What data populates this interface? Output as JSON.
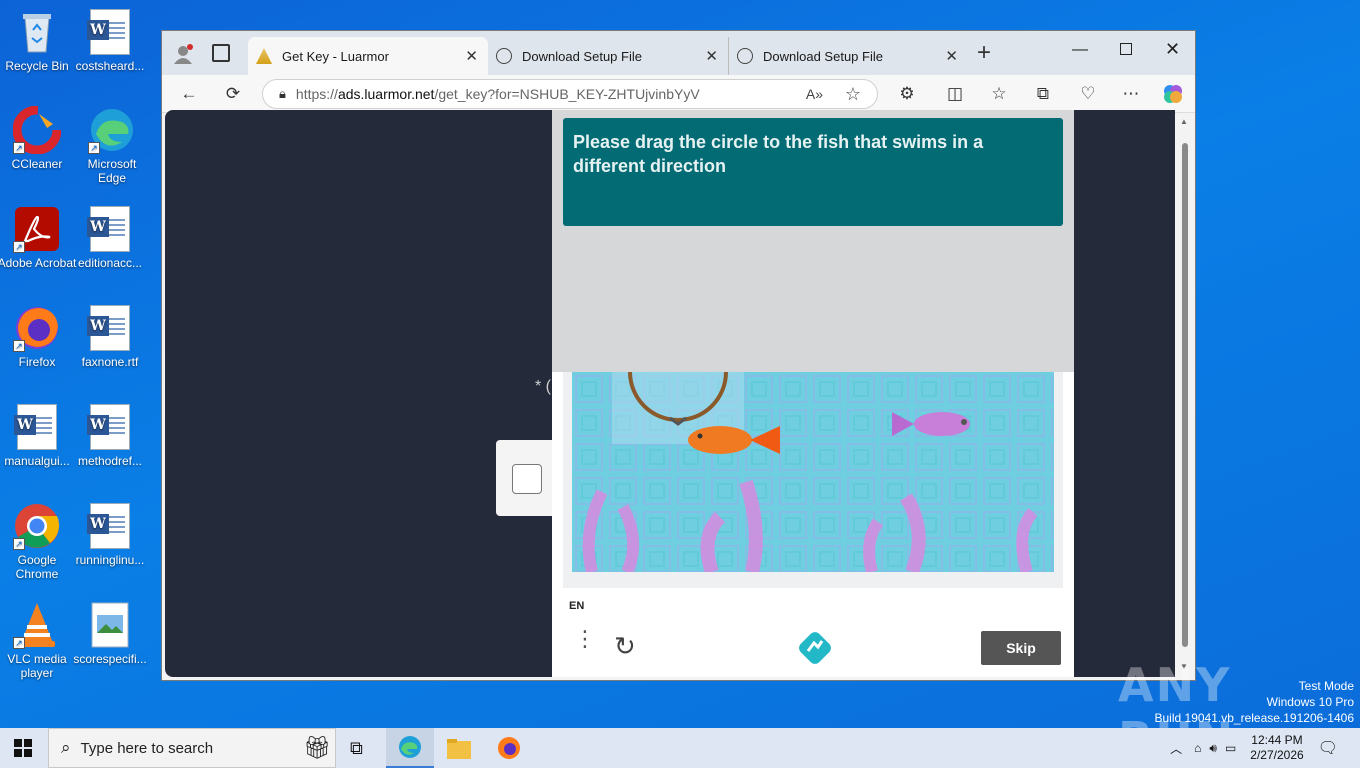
{
  "desktop": {
    "icons": [
      {
        "label": "Recycle Bin"
      },
      {
        "label": "costsheard..."
      },
      {
        "label": "CCleaner"
      },
      {
        "label": "Microsoft Edge"
      },
      {
        "label": "Adobe Acrobat"
      },
      {
        "label": "editionacc..."
      },
      {
        "label": "Firefox"
      },
      {
        "label": "faxnone.rtf"
      },
      {
        "label": "manualgui..."
      },
      {
        "label": "methodref..."
      },
      {
        "label": "Google Chrome"
      },
      {
        "label": "runninglinu..."
      },
      {
        "label": "VLC media player"
      },
      {
        "label": "scorespecifi..."
      }
    ]
  },
  "browser": {
    "tabs": [
      {
        "title": "Get Key - Luarmor",
        "active": true
      },
      {
        "title": "Download Setup File",
        "active": false
      },
      {
        "title": "Download Setup File",
        "active": false
      }
    ],
    "url_prefix": "https://",
    "url_host": "ads.luarmor.net",
    "url_path": "/get_key?for=NSHUB_KEY-ZHTUjvinbYyV"
  },
  "page": {
    "asterisk": "* (",
    "captcha": {
      "prompt": "Please drag the circle to the fish that swims in a different direction",
      "language": "EN",
      "skip_label": "Skip"
    }
  },
  "taskbar": {
    "search_placeholder": "Type here to search",
    "time": "12:44 PM",
    "date": "2/27/2026"
  },
  "watermark": {
    "line1": "Test Mode",
    "line2": "Windows 10 Pro",
    "line3": "Build 19041.vb_release.191206-1406",
    "brand": "ANY RUN"
  },
  "colors": {
    "desktop_bg": "#0a7fe6",
    "prompt_bg": "#026b74",
    "page_bg": "#252a3a",
    "skip_bg": "#555555"
  }
}
